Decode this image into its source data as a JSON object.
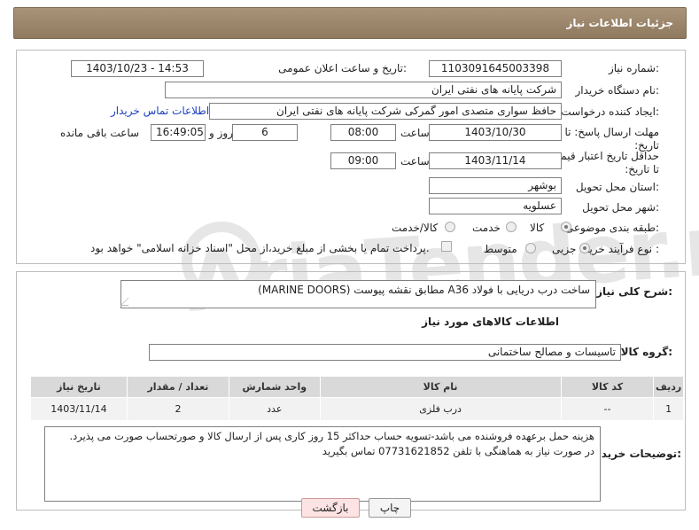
{
  "header": {
    "title": "جزئیات اطلاعات نیاز"
  },
  "form": {
    "need_number_label": "شماره نیاز:",
    "need_number": "1103091645003398",
    "announce_label": "تاریخ و ساعت اعلان عمومی:",
    "announce_value": "1403/10/23 - 14:53",
    "buyer_org_label": "نام دستگاه خریدار:",
    "buyer_org": "شرکت پایانه های نفتی ایران",
    "requester_label": "ایجاد کننده درخواست:",
    "requester": "حافظ سواری متصدی امور گمرکی شرکت پایانه های نفتی ایران",
    "contact_link": "اطلاعات تماس خریدار",
    "reply_deadline_label": "مهلت ارسال پاسخ: تا تاریخ:",
    "reply_date": "1403/10/30",
    "time_label": "ساعت",
    "reply_time": "08:00",
    "days_value": "6",
    "days_label": "روز و",
    "remaining_time": "16:49:05",
    "remaining_label": "ساعت باقی مانده",
    "price_deadline_label": "حداقل تاریخ اعتبار قیمت: تا تاریخ:",
    "price_date": "1403/11/14",
    "price_time": "09:00",
    "province_label": "استان محل تحویل:",
    "province": "بوشهر",
    "city_label": "شهر محل تحویل:",
    "city": "عسلویه",
    "category_label": "طبقه بندی موضوعی:",
    "category_options": [
      "کالا",
      "خدمت",
      "کالا/خدمت"
    ],
    "process_label": "نوع فرآیند خرید :",
    "process_options": [
      "جزیی",
      "متوسط"
    ],
    "payment_note": "پرداخت تمام یا بخشی از مبلغ خرید،از محل \"اسناد خزانه اسلامی\" خواهد بود."
  },
  "description": {
    "label": "شرح کلی نیاز:",
    "value": "ساخت درب دریایی با فولاد A36 مطابق نقشه پیوست (MARINE DOORS)"
  },
  "goods": {
    "section_title": "اطلاعات کالاهای مورد نیاز",
    "group_label": "گروه کالا:",
    "group_value": "تاسیسات و مصالح ساختمانی",
    "columns": [
      "ردیف",
      "کد کالا",
      "نام کالا",
      "واحد شمارش",
      "تعداد / مقدار",
      "تاریخ نیاز"
    ],
    "rows": [
      [
        "1",
        "--",
        "درب فلزی",
        "عدد",
        "2",
        "1403/11/14"
      ]
    ]
  },
  "buyer_notes": {
    "label": "توضیحات خریدار:",
    "line1": "هزینه حمل برعهده فروشنده می باشد-تسویه حساب حداکثر 15 روز کاری پس از ارسال کالا و صورتحساب صورت می پذیرد.",
    "line2": "در صورت نیاز به هماهنگی با تلفن 07731621852 تماس بگیرید"
  },
  "buttons": {
    "print": "چاپ",
    "back": "بازگشت"
  },
  "watermark": "AriaTender.neT"
}
